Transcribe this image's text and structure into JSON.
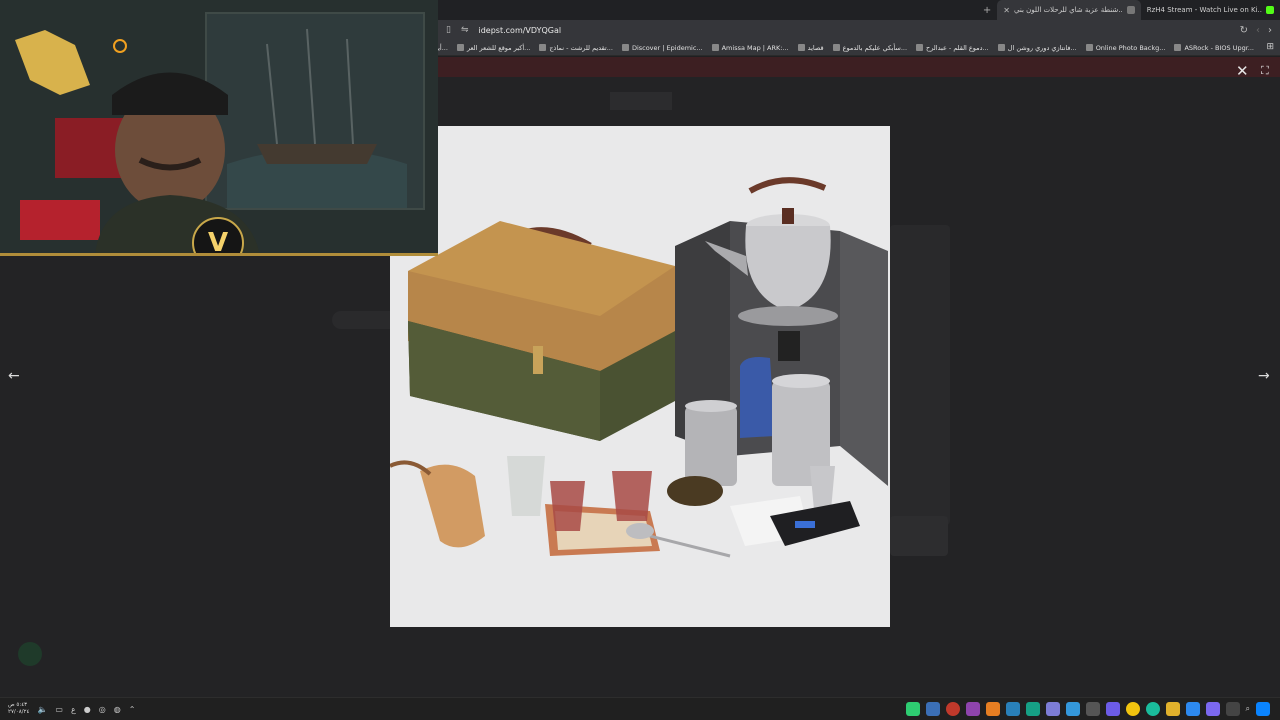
{
  "browser": {
    "tabs": [
      {
        "title": "RzH4 Stream - Watch Live on Ki..",
        "favicon": "kick-icon",
        "active": false
      },
      {
        "title": "شنطة عزبة شاي للرحلات اللون بني..",
        "favicon": "tab-page-icon",
        "active": true
      }
    ],
    "url": "idepst.com/VDYQGal",
    "bookmarks": [
      "ASRock - BIOS Upgr...",
      "Online Photo Backg...",
      "فانتازي دوري روشن ال...",
      "دموع القلم - عبدالرح...",
      "سأبكي عليكم بالدموع...",
      "قصايد",
      "Amissa Map | ARK:...",
      "Discover | Epidemic...",
      "تقديم للرشت - نماذج...",
      "أكبر موقع للشعر العر...",
      "أيهذا الشاكي وما بك..."
    ]
  },
  "banner_text": "",
  "lightbox": {
    "close_icon": "close-icon",
    "fullscreen_icon": "fullscreen-icon",
    "prev_icon": "arrow-left-icon",
    "next_icon": "arrow-right-icon"
  },
  "product_image": {
    "subject": "camping tea set bag with kettle, wind shield, gas burner, canisters, glasses, tray and scale"
  },
  "webcam": {
    "logo_letter": "V"
  },
  "taskbar": {
    "clock_time": "٥:٤٣ ص",
    "clock_date": "٢٧/٠٨/٢٤",
    "lang": "ع"
  },
  "colors": {
    "accent_gold": "#c9a84a",
    "kick_green": "#53fc18",
    "bag_tan": "#c4944f",
    "bag_olive": "#4a5232"
  }
}
